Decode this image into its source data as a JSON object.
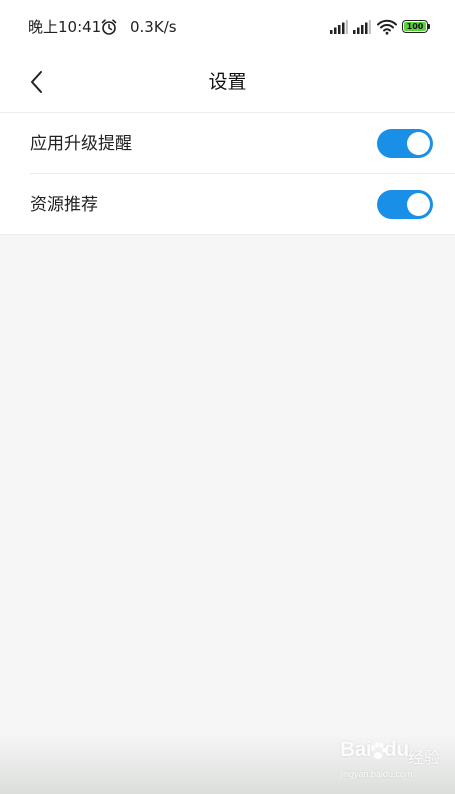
{
  "status_bar": {
    "time": "晚上10:41",
    "net_speed": "0.3K/s",
    "battery": "100",
    "battery_color": "#5ad23a"
  },
  "header": {
    "title": "设置",
    "back_icon": "chevron-left-icon"
  },
  "settings": [
    {
      "label": "应用升级提醒",
      "enabled": true
    },
    {
      "label": "资源推荐",
      "enabled": true
    }
  ],
  "colors": {
    "toggle_on": "#1a8fe8",
    "background": "#f5f6f5"
  },
  "watermark": {
    "brand_left": "Bai",
    "brand_right": "du",
    "suffix": "经验",
    "url": "jingyan.baidu.com"
  }
}
